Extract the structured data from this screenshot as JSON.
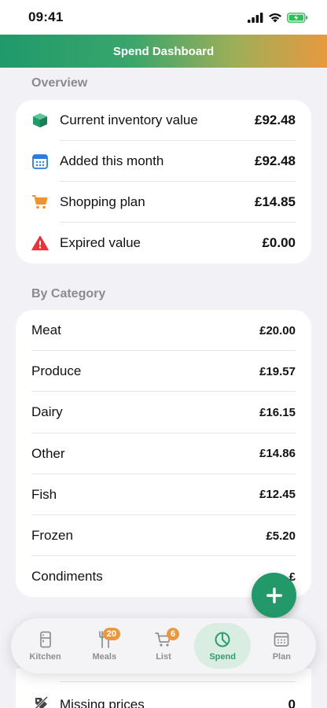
{
  "status_bar": {
    "time": "09:41"
  },
  "header": {
    "title": "Spend Dashboard"
  },
  "overview": {
    "title": "Overview",
    "rows": [
      {
        "icon": "box-icon",
        "label": "Current inventory value",
        "value": "£92.48"
      },
      {
        "icon": "calendar-icon",
        "label": "Added this month",
        "value": "£92.48"
      },
      {
        "icon": "cart-icon",
        "label": "Shopping plan",
        "value": "£14.85"
      },
      {
        "icon": "warning-icon",
        "label": "Expired value",
        "value": "£0.00"
      }
    ]
  },
  "by_category": {
    "title": "By Category",
    "rows": [
      {
        "label": "Meat",
        "value": "£20.00"
      },
      {
        "label": "Produce",
        "value": "£19.57"
      },
      {
        "label": "Dairy",
        "value": "£16.15"
      },
      {
        "label": "Other",
        "value": "£14.86"
      },
      {
        "label": "Fish",
        "value": "£12.45"
      },
      {
        "label": "Frozen",
        "value": "£5.20"
      },
      {
        "label": "Condiments",
        "value": "£"
      }
    ]
  },
  "below": {
    "label": "Missing prices",
    "value": "0"
  },
  "fab": {
    "icon": "plus-icon"
  },
  "tabs": [
    {
      "label": "Kitchen",
      "icon": "fridge-icon",
      "badge": ""
    },
    {
      "label": "Meals",
      "icon": "fork-knife-icon",
      "badge": "20"
    },
    {
      "label": "List",
      "icon": "cart-icon",
      "badge": "6"
    },
    {
      "label": "Spend",
      "icon": "pie-chart-icon",
      "badge": "",
      "active": true
    },
    {
      "label": "Plan",
      "icon": "calendar-icon",
      "badge": ""
    }
  ],
  "colors": {
    "accent": "#23996a",
    "header_gradient_start": "#1f9a6a",
    "header_gradient_end": "#e8993f",
    "badge": "#e8993f",
    "warning": "#e8333a"
  }
}
